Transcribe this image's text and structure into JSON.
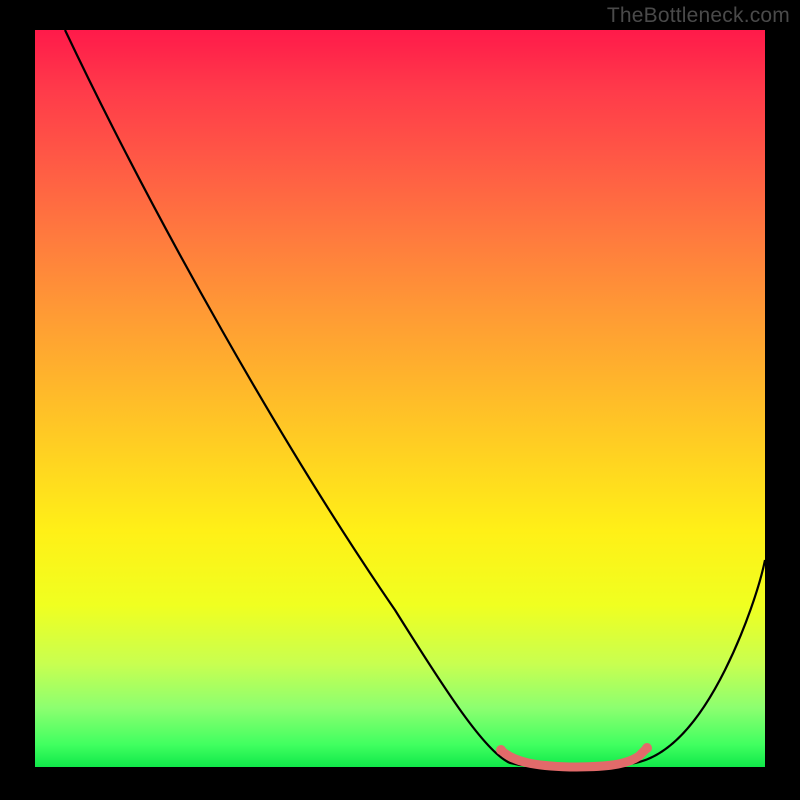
{
  "watermark": "TheBottleneck.com",
  "chart_data": {
    "type": "line",
    "title": "",
    "xlabel": "",
    "ylabel": "",
    "xlim": [
      0,
      100
    ],
    "ylim": [
      0,
      100
    ],
    "grid": false,
    "series": [
      {
        "name": "curve",
        "color": "#000000",
        "x": [
          4,
          8,
          12,
          16,
          20,
          24,
          28,
          32,
          36,
          40,
          44,
          48,
          52,
          56,
          60,
          64,
          68,
          72,
          76,
          80,
          84,
          88,
          92,
          96,
          100
        ],
        "values": [
          100,
          94,
          87,
          81,
          74,
          68,
          61,
          55,
          48,
          42,
          35,
          29,
          22,
          16,
          10,
          5,
          1,
          0,
          0,
          0,
          1,
          5,
          12,
          22,
          34
        ]
      },
      {
        "name": "flat-highlight",
        "color": "#e26a6a",
        "x": [
          64,
          68,
          72,
          76,
          80,
          83
        ],
        "values": [
          2,
          0.2,
          0,
          0,
          0.2,
          2
        ]
      }
    ],
    "palette": {
      "gradient_top": "#ff1a4a",
      "gradient_mid": "#ffe617",
      "gradient_bottom": "#10e84a",
      "highlight": "#e26a6a",
      "curve": "#000000",
      "background": "#000000"
    }
  }
}
